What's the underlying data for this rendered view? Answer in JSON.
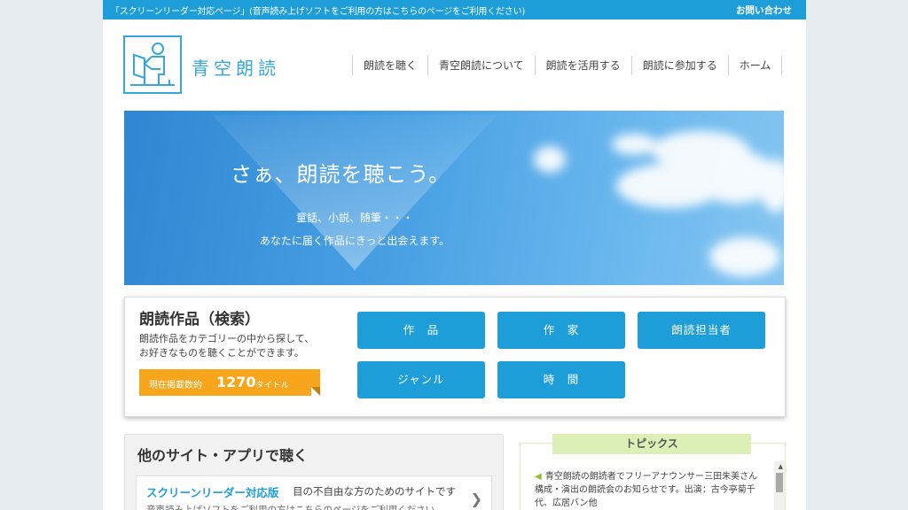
{
  "topbar": {
    "note": "「スクリーンリーダー対応ページ」(音声読み上げソフトをご利用の方はこちらのページをご利用ください)",
    "contact": "お問い合わせ"
  },
  "header": {
    "logo_text": "青空朗読",
    "nav": [
      "朗読を聴く",
      "青空朗読について",
      "朗読を活用する",
      "朗読に参加する",
      "ホーム"
    ]
  },
  "hero": {
    "title": "さぁ、朗読を聴こう。",
    "sub1": "童話、小説、随筆・・・",
    "sub2": "あなたに届く作品にきっと出会えます。"
  },
  "search": {
    "title": "朗読作品（検索）",
    "desc1": "朗読作品をカテゴリーの中から探して、",
    "desc2": "お好きなものを聴くことができます。",
    "count_label": "現在掲載数約",
    "count": "1270",
    "count_unit": "タイトル",
    "categories": [
      "作　品",
      "作　家",
      "朗読担当者",
      "ジャンル",
      "時　間"
    ]
  },
  "apps": {
    "title": "他のサイト・アプリで聴く",
    "card_name": "スクリーンリーダー対応版",
    "card_sub": "目の不自由な方のためのサイトです",
    "card_desc": "音声読み上げソフトをご利用の方はこちらのページをご利用ください"
  },
  "topics": {
    "title": "トピックス",
    "text": "青空朗読の朗読者でフリーアナウンサー三田朱美さん構成・演出の朗読会のお知らせです。出演：古今亭菊千代、広居バン他"
  },
  "colors": {
    "brand": "#1d9ed9",
    "accent": "#f7a51b",
    "topics_head": "#dcefb6"
  }
}
